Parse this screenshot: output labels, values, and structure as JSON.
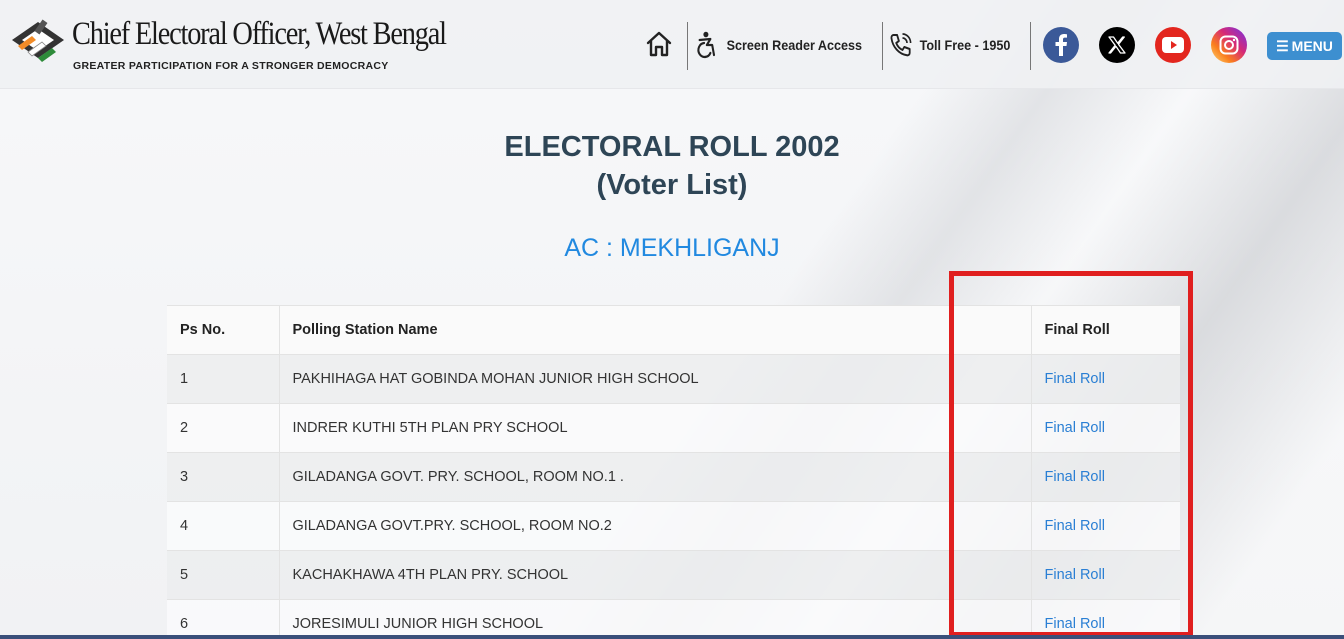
{
  "header": {
    "brand_title": "Chief Electoral Officer, West Bengal",
    "brand_tagline": "GREATER PARTICIPATION FOR A STRONGER DEMOCRACY",
    "nav": {
      "screen_reader": "Screen Reader Access",
      "toll_free": "Toll Free - 1950",
      "menu": "MENU"
    },
    "social": {
      "facebook_color": "#3b5998",
      "x_color": "#000000",
      "youtube_color": "#e3261e",
      "instagram_color": "#d62976"
    }
  },
  "main": {
    "title_line1": "ELECTORAL ROLL 2002",
    "title_line2": "(Voter List)",
    "ac_label": "AC : MEKHLIGANJ",
    "table": {
      "headers": [
        "Ps No.",
        "Polling Station Name",
        "Final Roll"
      ],
      "rows": [
        {
          "ps": "1",
          "name": "PAKHIHAGA HAT GOBINDA MOHAN JUNIOR HIGH SCHOOL",
          "link": "Final Roll"
        },
        {
          "ps": "2",
          "name": "INDRER KUTHI 5TH PLAN PRY SCHOOL",
          "link": "Final Roll"
        },
        {
          "ps": "3",
          "name": "GILADANGA GOVT. PRY. SCHOOL, ROOM NO.1 .",
          "link": "Final Roll"
        },
        {
          "ps": "4",
          "name": "GILADANGA GOVT.PRY. SCHOOL, ROOM NO.2",
          "link": "Final Roll"
        },
        {
          "ps": "5",
          "name": "KACHAKHAWA 4TH PLAN PRY. SCHOOL",
          "link": "Final Roll"
        },
        {
          "ps": "6",
          "name": "JORESIMULI JUNIOR HIGH SCHOOL",
          "link": "Final Roll"
        }
      ]
    }
  },
  "colors": {
    "accent_blue": "#2189e0",
    "link_blue": "#2a7fd4",
    "highlight_red": "#e01f1f",
    "title_color": "#2e4556"
  }
}
